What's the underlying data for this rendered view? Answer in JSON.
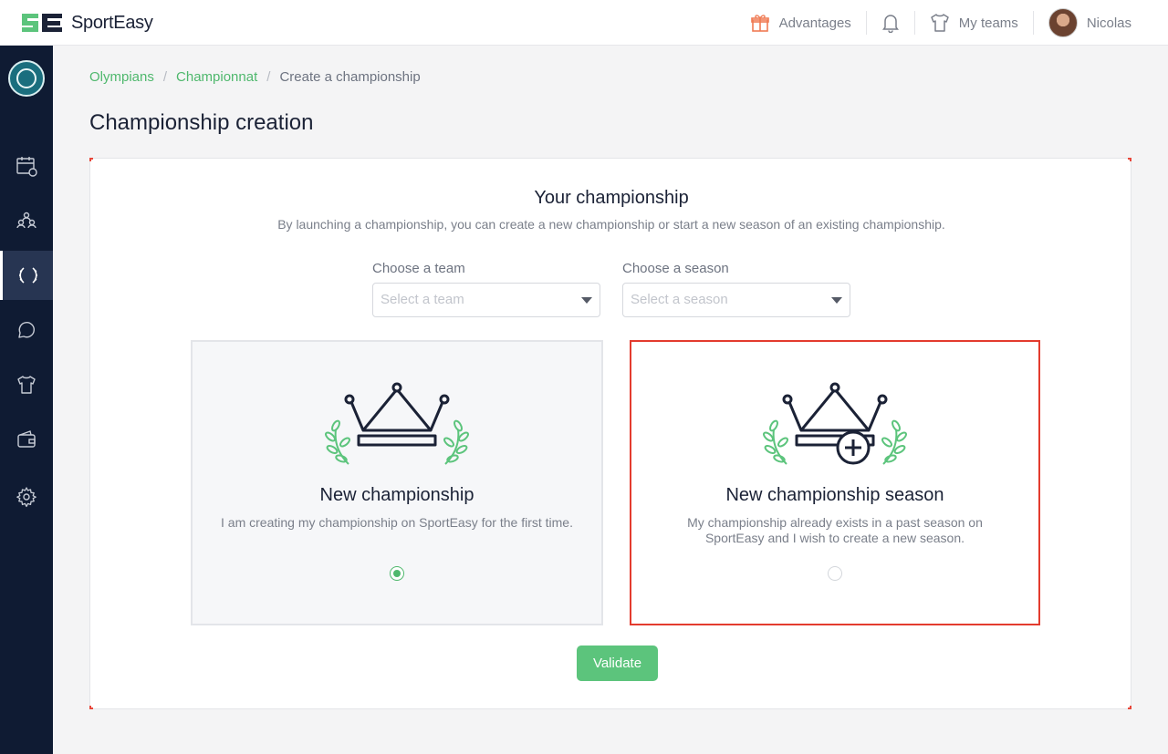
{
  "header": {
    "logo_text": "SportEasy",
    "advantages_label": "Advantages",
    "my_teams_label": "My teams",
    "user_name": "Nicolas"
  },
  "sidebar": {
    "items": [
      {
        "icon": "calendar-icon"
      },
      {
        "icon": "members-icon"
      },
      {
        "icon": "laurel-icon",
        "active": true
      },
      {
        "icon": "chat-icon"
      },
      {
        "icon": "jersey-icon"
      },
      {
        "icon": "wallet-icon"
      },
      {
        "icon": "gear-icon"
      }
    ]
  },
  "breadcrumb": {
    "items": [
      "Olympians",
      "Championnat",
      "Create a championship"
    ],
    "separator": "/"
  },
  "page": {
    "title": "Championship creation"
  },
  "form": {
    "section_title": "Your championship",
    "section_subtitle": "By launching a championship, you can create a new championship or start a new season of an existing championship.",
    "team_label": "Choose a team",
    "team_placeholder": "Select a team",
    "season_label": "Choose a season",
    "season_placeholder": "Select a season",
    "options": [
      {
        "title": "New championship",
        "description": "I am creating my championship on SportEasy for the first time.",
        "selected": true
      },
      {
        "title": "New championship season",
        "description": "My championship already exists in a past season on SportEasy and I wish to create a new season.",
        "selected": false
      }
    ],
    "validate_label": "Validate"
  },
  "colors": {
    "accent_green": "#5cc47c",
    "sidebar_navy": "#0f1b33",
    "highlight_red": "#e33b2e"
  }
}
